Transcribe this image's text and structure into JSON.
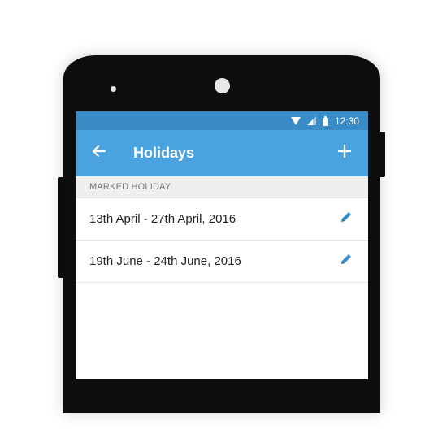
{
  "status_bar": {
    "time": "12:30",
    "icons": [
      "wifi-icon",
      "signal-icon",
      "battery-icon"
    ]
  },
  "app_bar": {
    "title": "Holidays",
    "back_icon": "arrow-back-icon",
    "add_icon": "plus-icon"
  },
  "section": {
    "header": "MARKED HOLIDAY"
  },
  "holidays": [
    {
      "label": "13th April - 27th April, 2016",
      "action_icon": "pencil-icon"
    },
    {
      "label": "19th June - 24th June, 2016",
      "action_icon": "pencil-icon"
    }
  ],
  "colors": {
    "status_bar": "#3a8cc7",
    "app_bar": "#4aa3df",
    "accent": "#3a8cc7",
    "device": "#0d0d0d"
  }
}
